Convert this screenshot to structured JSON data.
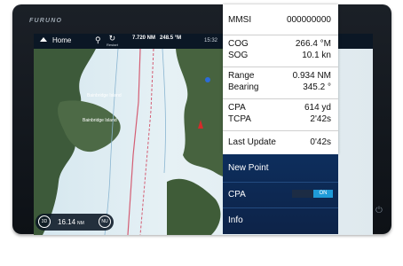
{
  "device": {
    "brand": "FURUNO"
  },
  "topbar": {
    "home_label": "Home",
    "restart_label": "Restart",
    "distance": "7.720 NM",
    "bearing": "248.5 °M",
    "time": "15:32"
  },
  "scale": {
    "left_button": "3D",
    "value": "16.14",
    "unit": "NM",
    "right_button": "NU"
  },
  "map": {
    "labels": [
      "Bainbridge Island",
      "Bainbridge Island"
    ]
  },
  "info": {
    "mmsi": {
      "label": "MMSI",
      "value": "000000000"
    },
    "cog": {
      "label": "COG",
      "value": "266.4 °M"
    },
    "sog": {
      "label": "SOG",
      "value": "10.1 kn"
    },
    "range": {
      "label": "Range",
      "value": "0.934 NM"
    },
    "bearing": {
      "label": "Bearing",
      "value": "345.2 °"
    },
    "cpa": {
      "label": "CPA",
      "value": "614 yd"
    },
    "tcpa": {
      "label": "TCPA",
      "value": "2'42s"
    },
    "last_update": {
      "label": "Last Update",
      "value": "0'42s"
    }
  },
  "menu": {
    "new_point": "New Point",
    "cpa_label": "CPA",
    "cpa_toggle": "ON",
    "info": "Info"
  },
  "colors": {
    "panel_blue": "#0d2e5d",
    "toggle_on": "#1f9bd8"
  },
  "icons": [
    "home-icon",
    "pin-icon",
    "restart-icon",
    "power-icon"
  ]
}
